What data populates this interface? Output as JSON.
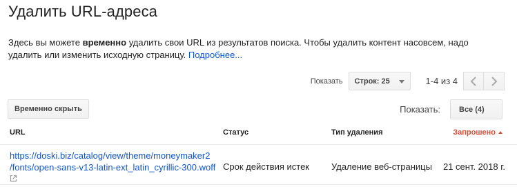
{
  "page": {
    "title": "Удалить URL-адреса",
    "description": {
      "part1": "Здесь вы можете ",
      "bold": "временно",
      "part2": " удалить свои URL из результатов поиска. Чтобы удалить контент насовсем, надо удалить или изменить исходную страницу. ",
      "link": "Подробнее..."
    }
  },
  "pager": {
    "show_label": "Показать",
    "rows_select": "Строк: 25",
    "range": "1-4 из 4"
  },
  "toolbar": {
    "hide_button": "Временно скрыть",
    "filter_label": "Показать:",
    "filter_value": "Все (4)"
  },
  "table": {
    "columns": {
      "url": "URL",
      "status": "Статус",
      "type": "Тип удаления",
      "requested": "Запрошено"
    },
    "rows": [
      {
        "url_line1": "https://doski.biz/catalog/view/theme/moneymaker2",
        "url_line2": "/fonts/open-sans-v13-latin-ext_latin_cyrillic-300.woff",
        "status": "Срок действия истек",
        "type": "Удаление веб-страницы",
        "requested": "21 сент. 2018 г."
      }
    ]
  },
  "colors": {
    "link": "#1155cc",
    "sorted_header": "#dd4b39"
  }
}
